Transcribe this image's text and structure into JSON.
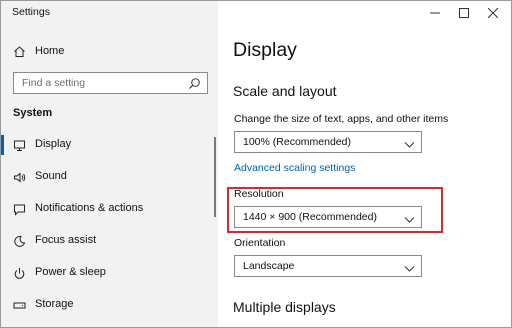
{
  "window": {
    "title": "Settings",
    "controls": [
      "minimize",
      "maximize",
      "close"
    ]
  },
  "sidebar": {
    "home_label": "Home",
    "home_icon": "home-icon",
    "search_placeholder": "Find a setting",
    "section_title": "System",
    "items": [
      {
        "label": "Display",
        "icon": "monitor-icon",
        "active": true
      },
      {
        "label": "Sound",
        "icon": "speaker-icon",
        "active": false
      },
      {
        "label": "Notifications & actions",
        "icon": "notification-icon",
        "active": false
      },
      {
        "label": "Focus assist",
        "icon": "moon-icon",
        "active": false
      },
      {
        "label": "Power & sleep",
        "icon": "power-icon",
        "active": false
      },
      {
        "label": "Storage",
        "icon": "storage-icon",
        "active": false
      }
    ]
  },
  "main": {
    "page_title": "Display",
    "scale_heading": "Scale and layout",
    "scale_label": "Change the size of text, apps, and other items",
    "scale_value": "100% (Recommended)",
    "advanced_link": "Advanced scaling settings",
    "resolution_label": "Resolution",
    "resolution_value": "1440 × 900 (Recommended)",
    "orientation_label": "Orientation",
    "orientation_value": "Landscape",
    "multiple_heading": "Multiple displays"
  },
  "colors": {
    "sidebar_bg": "#f2f2f2",
    "accent": "#0063b1",
    "highlight": "#e3242b"
  }
}
